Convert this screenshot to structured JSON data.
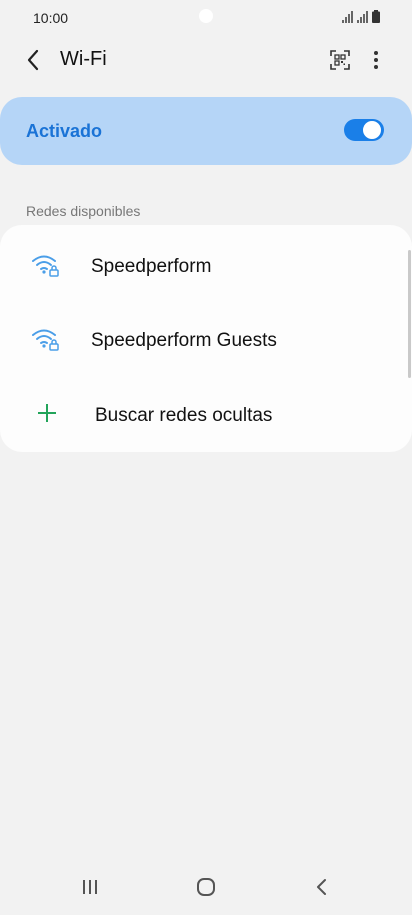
{
  "status_bar": {
    "time": "10:00"
  },
  "app_bar": {
    "title": "Wi-Fi",
    "icons": [
      "back-icon",
      "qr-code-icon",
      "more-vert-icon"
    ]
  },
  "wifi_toggle": {
    "label": "Activado",
    "enabled": true,
    "accent_color": "#1a7fe8",
    "card_color": "#b5d5f7"
  },
  "available_networks": {
    "section_title": "Redes disponibles",
    "networks": [
      {
        "name": "Speedperform",
        "icon": "wifi-lock-icon"
      },
      {
        "name": "Speedperform Guests",
        "icon": "wifi-lock-icon"
      }
    ],
    "add_network_label": "Buscar redes ocultas"
  },
  "nav_bar": {
    "icons": [
      "recents-icon",
      "home-icon",
      "back-icon"
    ]
  }
}
